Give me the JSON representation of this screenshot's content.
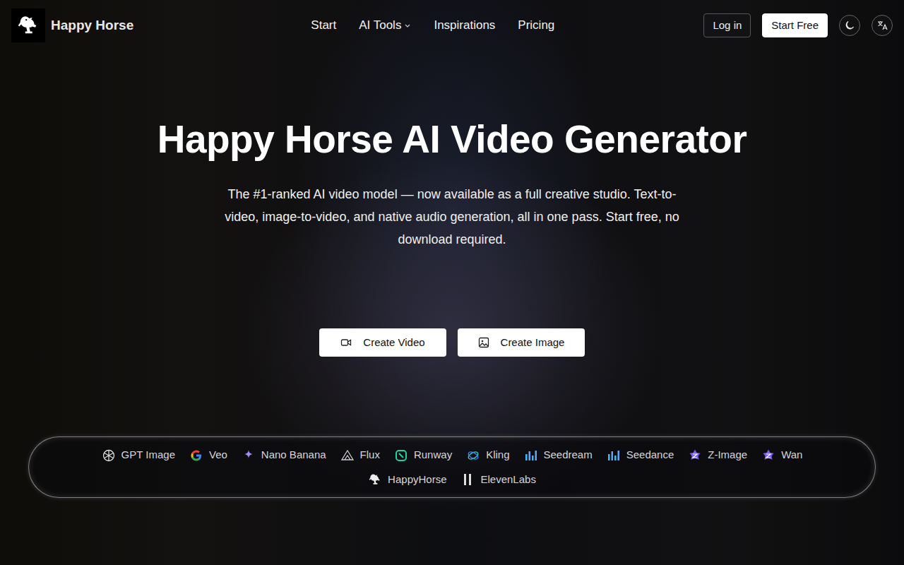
{
  "brand": {
    "name": "Happy Horse"
  },
  "nav": {
    "links": [
      {
        "label": "Start",
        "kind": "link"
      },
      {
        "label": "AI Tools",
        "kind": "dropdown"
      },
      {
        "label": "Inspirations",
        "kind": "link"
      },
      {
        "label": "Pricing",
        "kind": "link"
      }
    ]
  },
  "actions": {
    "login": "Log in",
    "start": "Start Free"
  },
  "hero": {
    "title": "Happy Horse AI Video Generator",
    "subtitle": "The #1-ranked AI video model — now available as a full creative studio. Text-to-video, image-to-video, and native audio generation, all in one pass. Start free, no download required.",
    "buttons": [
      {
        "label": "Create Video",
        "kind": "video"
      },
      {
        "label": "Create Image",
        "kind": "image"
      }
    ]
  },
  "models": [
    {
      "name": "GPT Image",
      "kind": "openai"
    },
    {
      "name": "Veo",
      "kind": "google"
    },
    {
      "name": "Nano Banana",
      "kind": "sparkle"
    },
    {
      "name": "Flux",
      "kind": "flux"
    },
    {
      "name": "Runway",
      "kind": "runway"
    },
    {
      "name": "Kling",
      "kind": "kling"
    },
    {
      "name": "Seedream",
      "kind": "bars"
    },
    {
      "name": "Seedance",
      "kind": "bars"
    },
    {
      "name": "Z-Image",
      "kind": "star"
    },
    {
      "name": "Wan",
      "kind": "star"
    },
    {
      "name": "HappyHorse",
      "kind": "horse"
    },
    {
      "name": "ElevenLabs",
      "kind": "eleven"
    }
  ]
}
